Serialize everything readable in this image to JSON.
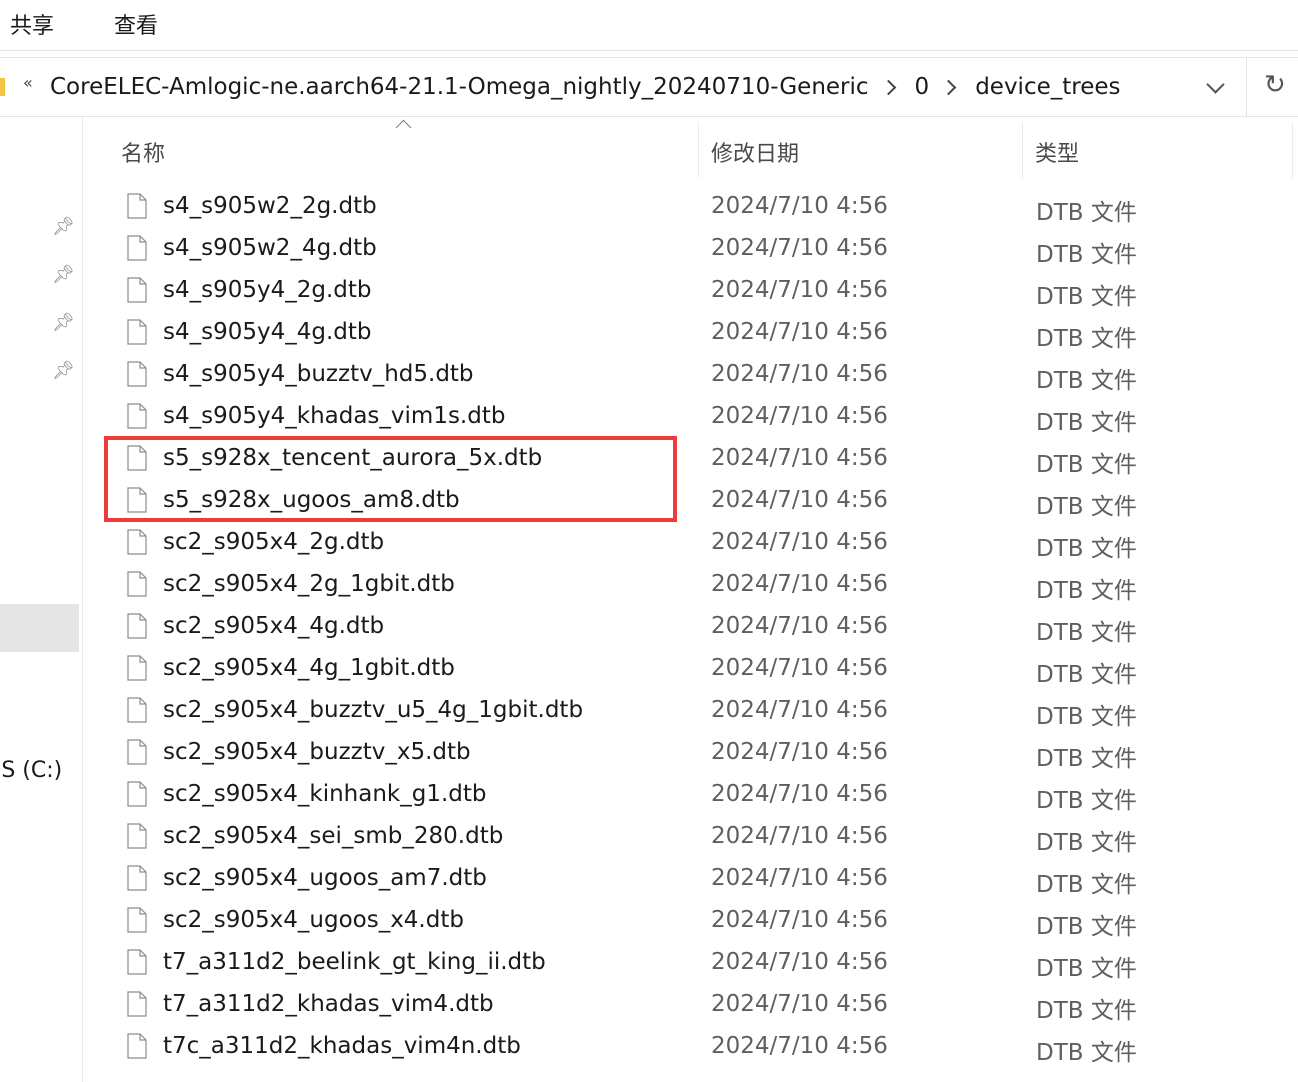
{
  "ribbon": {
    "tabs": [
      "共享",
      "查看"
    ]
  },
  "address": {
    "overflow": "«",
    "breadcrumb": [
      "CoreELEC-Amlogic-ne.aarch64-21.1-Omega_nightly_20240710-Generic",
      "0",
      "device_trees"
    ],
    "refresh_glyph": "↻"
  },
  "nav": {
    "drive_label": "OS (C:)"
  },
  "columns": {
    "name": "名称",
    "date": "修改日期",
    "type": "类型"
  },
  "files": [
    {
      "name": "s4_s905w2_2g.dtb",
      "date": "2024/7/10 4:56",
      "type": "DTB 文件"
    },
    {
      "name": "s4_s905w2_4g.dtb",
      "date": "2024/7/10 4:56",
      "type": "DTB 文件"
    },
    {
      "name": "s4_s905y4_2g.dtb",
      "date": "2024/7/10 4:56",
      "type": "DTB 文件"
    },
    {
      "name": "s4_s905y4_4g.dtb",
      "date": "2024/7/10 4:56",
      "type": "DTB 文件"
    },
    {
      "name": "s4_s905y4_buzztv_hd5.dtb",
      "date": "2024/7/10 4:56",
      "type": "DTB 文件"
    },
    {
      "name": "s4_s905y4_khadas_vim1s.dtb",
      "date": "2024/7/10 4:56",
      "type": "DTB 文件"
    },
    {
      "name": "s5_s928x_tencent_aurora_5x.dtb",
      "date": "2024/7/10 4:56",
      "type": "DTB 文件"
    },
    {
      "name": "s5_s928x_ugoos_am8.dtb",
      "date": "2024/7/10 4:56",
      "type": "DTB 文件"
    },
    {
      "name": "sc2_s905x4_2g.dtb",
      "date": "2024/7/10 4:56",
      "type": "DTB 文件"
    },
    {
      "name": "sc2_s905x4_2g_1gbit.dtb",
      "date": "2024/7/10 4:56",
      "type": "DTB 文件"
    },
    {
      "name": "sc2_s905x4_4g.dtb",
      "date": "2024/7/10 4:56",
      "type": "DTB 文件"
    },
    {
      "name": "sc2_s905x4_4g_1gbit.dtb",
      "date": "2024/7/10 4:56",
      "type": "DTB 文件"
    },
    {
      "name": "sc2_s905x4_buzztv_u5_4g_1gbit.dtb",
      "date": "2024/7/10 4:56",
      "type": "DTB 文件"
    },
    {
      "name": "sc2_s905x4_buzztv_x5.dtb",
      "date": "2024/7/10 4:56",
      "type": "DTB 文件"
    },
    {
      "name": "sc2_s905x4_kinhank_g1.dtb",
      "date": "2024/7/10 4:56",
      "type": "DTB 文件"
    },
    {
      "name": "sc2_s905x4_sei_smb_280.dtb",
      "date": "2024/7/10 4:56",
      "type": "DTB 文件"
    },
    {
      "name": "sc2_s905x4_ugoos_am7.dtb",
      "date": "2024/7/10 4:56",
      "type": "DTB 文件"
    },
    {
      "name": "sc2_s905x4_ugoos_x4.dtb",
      "date": "2024/7/10 4:56",
      "type": "DTB 文件"
    },
    {
      "name": "t7_a311d2_beelink_gt_king_ii.dtb",
      "date": "2024/7/10 4:56",
      "type": "DTB 文件"
    },
    {
      "name": "t7_a311d2_khadas_vim4.dtb",
      "date": "2024/7/10 4:56",
      "type": "DTB 文件"
    },
    {
      "name": "t7c_a311d2_khadas_vim4n.dtb",
      "date": "2024/7/10 4:56",
      "type": "DTB 文件"
    }
  ],
  "colors": {
    "highlight": "#ee3b3b",
    "selected_nav": "#e5e5e5"
  }
}
